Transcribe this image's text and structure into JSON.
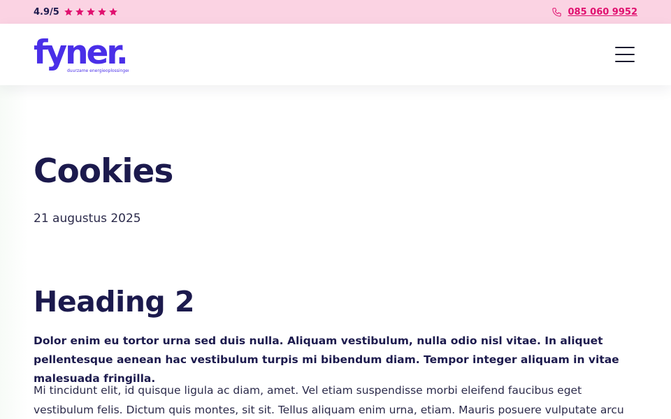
{
  "topbar": {
    "rating": "4.9/5",
    "stars": 5,
    "star_color": "#e0106f",
    "phone_icon": "phone-icon",
    "phone": "085 060 9952"
  },
  "header": {
    "logo_text": "fyner.",
    "logo_tagline": "duurzame energieoplossingen",
    "logo_color": "#4a2fe8",
    "menu_icon": "hamburger-menu-icon"
  },
  "page": {
    "title": "Cookies",
    "date": "21 augustus 2025",
    "heading": "Heading 2",
    "lead": "Dolor enim eu tortor urna sed duis nulla. Aliquam vestibulum, nulla odio nisl vitae. In aliquet pellentesque aenean hac vestibulum turpis mi bibendum diam. Tempor integer aliquam in vitae malesuada fringilla.",
    "body": "Mi tincidunt elit, id quisque ligula ac diam, amet. Vel etiam suspendisse morbi eleifend faucibus eget vestibulum felis. Dictum quis montes, sit sit. Tellus aliquam enim urna, etiam. Mauris posuere vulputate arcu amet, vitae nisi, tellus"
  },
  "colors": {
    "topbar_bg": "#fbd3e3",
    "accent": "#e0106f",
    "text_dark": "#1c1a4d"
  }
}
